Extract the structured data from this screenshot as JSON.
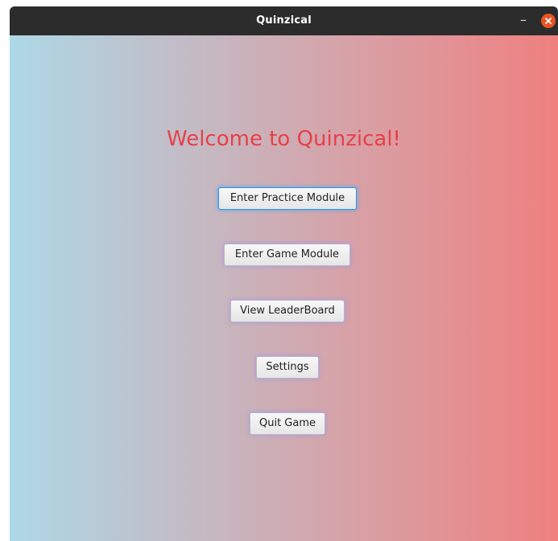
{
  "window": {
    "title": "Quinzical",
    "minimize_symbol": "–"
  },
  "main": {
    "welcome_text": "Welcome to Quinzical!",
    "buttons": {
      "practice": "Enter Practice Module",
      "game": "Enter Game Module",
      "leaderboard": "View LeaderBoard",
      "settings": "Settings",
      "quit": "Quit Game"
    }
  },
  "colors": {
    "gradient_start": "#add8e6",
    "gradient_end": "#f08080",
    "welcome_text": "#e8404a",
    "close_button": "#e95420",
    "titlebar": "#2c2c2c"
  },
  "icons": {
    "close": "close-icon",
    "minimize": "minimize-icon"
  }
}
